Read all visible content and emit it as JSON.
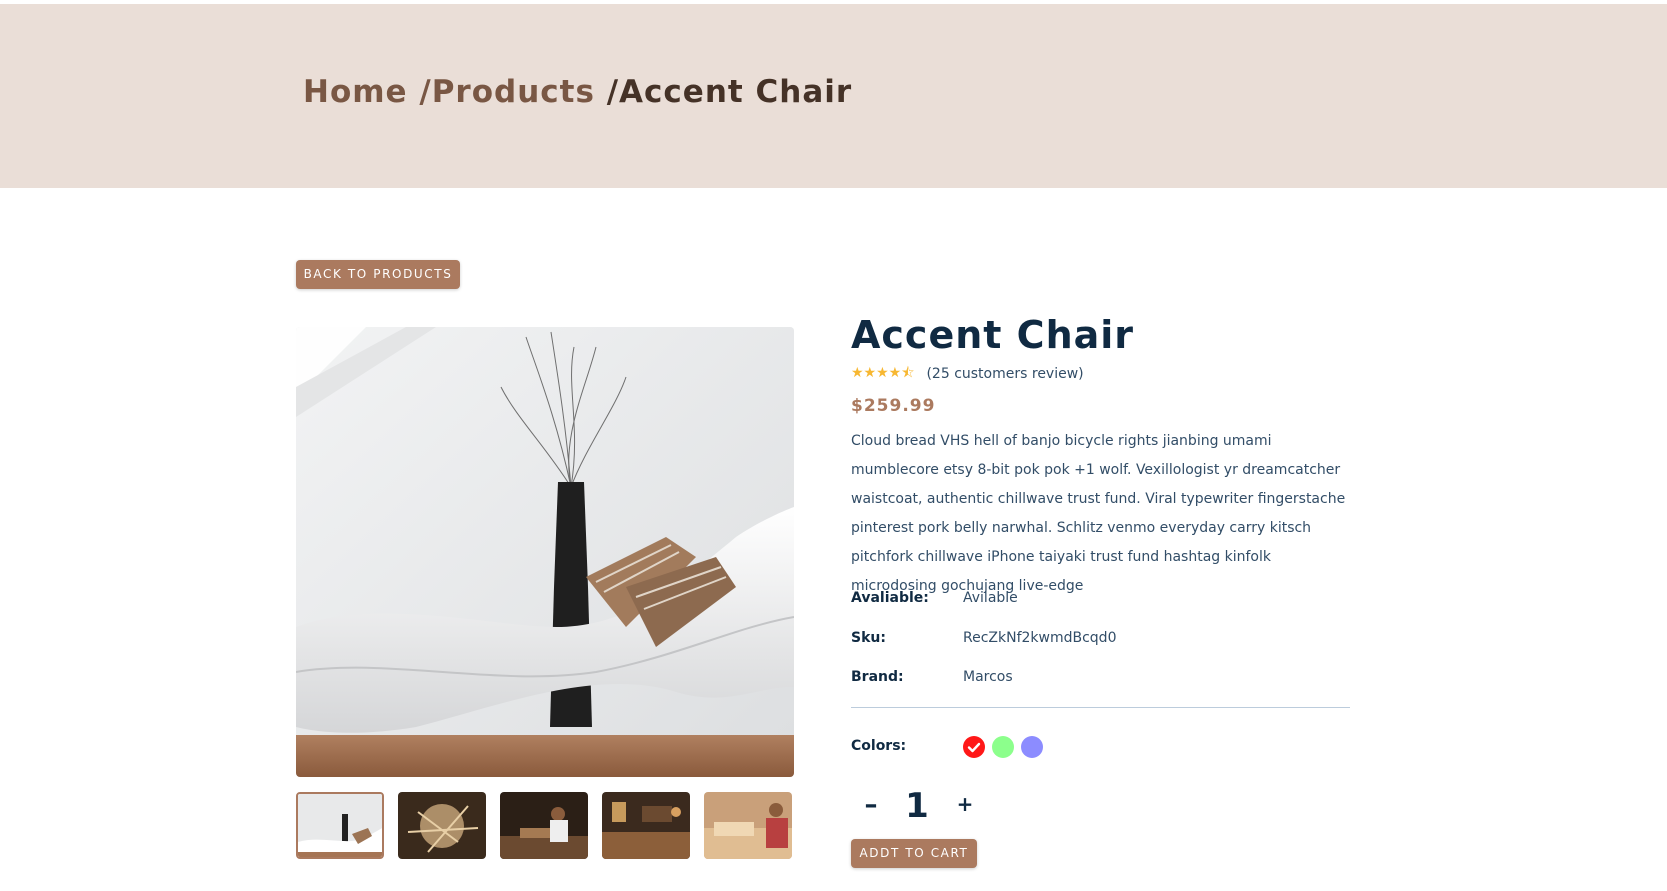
{
  "breadcrumb": {
    "home": "Home",
    "sep1": " /",
    "products": "Products",
    "sep2": " /",
    "current": "Accent Chair"
  },
  "back_button": "BACK TO PRODUCTS",
  "product": {
    "title": "Accent Chair",
    "rating": 4.5,
    "stars": "★★★★⯪",
    "reviews": "(25 customers review)",
    "price": "$259.99",
    "description": "Cloud bread VHS hell of banjo bicycle rights jianbing umami mumblecore etsy 8-bit pok pok +1 wolf. Vexillologist yr dreamcatcher waistcoat, authentic chillwave trust fund. Viral typewriter fingerstache pinterest pork belly narwhal. Schlitz venmo everyday carry kitsch pitchfork chillwave iPhone taiyaki trust fund hashtag kinfolk microdosing gochujang live-edge",
    "available_label": "Avaliable:",
    "available_value": "Avilable",
    "sku_label": "Sku:",
    "sku_value": "RecZkNf2kwmdBcqd0",
    "brand_label": "Brand:",
    "brand_value": "Marcos",
    "colors_label": "Colors:",
    "colors": [
      "#ff0000",
      "#00ff00",
      "#0000ff"
    ],
    "selected_color": "#ff0000",
    "quantity": "1",
    "minus": "–",
    "plus": "+",
    "add_to_cart": "ADDT TO CART"
  },
  "images": {
    "count": 5,
    "active_index": 0
  },
  "theme": {
    "accent": "#ab7a5f",
    "hero_bg": "#eaded7",
    "heading": "#102a42"
  }
}
